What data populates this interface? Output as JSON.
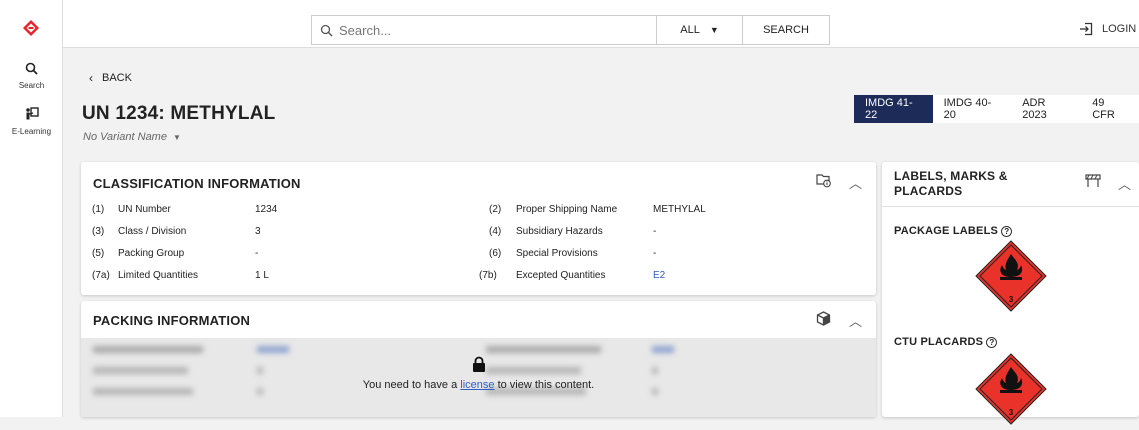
{
  "sidebar": {
    "logo": "logo-icon",
    "items": [
      {
        "label": "Search",
        "icon": "search-icon"
      },
      {
        "label": "E-Learning",
        "icon": "e-learning-icon"
      }
    ]
  },
  "topbar": {
    "search_placeholder": "Search...",
    "scope": "ALL",
    "search_button": "SEARCH",
    "login": "LOGIN"
  },
  "nav": {
    "back": "BACK"
  },
  "page": {
    "title": "UN 1234: METHYLAL",
    "variant": "No Variant Name"
  },
  "versions": [
    {
      "label": "IMDG 41-22",
      "active": true
    },
    {
      "label": "IMDG 40-20",
      "active": false
    },
    {
      "label": "ADR 2023",
      "active": false
    },
    {
      "label": "49 CFR",
      "active": false
    }
  ],
  "classification": {
    "title": "CLASSIFICATION INFORMATION",
    "rows": [
      {
        "num": "(1)",
        "label": "UN Number",
        "value": "1234"
      },
      {
        "num": "(3)",
        "label": "Class / Division",
        "value": "3"
      },
      {
        "num": "(5)",
        "label": "Packing Group",
        "value": "-"
      },
      {
        "num": "(7a)",
        "label": "Limited Quantities",
        "value": "1 L"
      }
    ],
    "rows_right": [
      {
        "num": "(2)",
        "label": "Proper Shipping Name",
        "value": "METHYLAL"
      },
      {
        "num": "(4)",
        "label": "Subsidiary Hazards",
        "value": "-"
      },
      {
        "num": "(6)",
        "label": "Special Provisions",
        "value": "-"
      },
      {
        "num": "(7b)",
        "label": "Excepted Quantities",
        "value": "E2"
      }
    ]
  },
  "packing": {
    "title": "PACKING INFORMATION",
    "locked_prefix": "You need to have a ",
    "locked_link": "license",
    "locked_suffix": " to view this content."
  },
  "labels": {
    "title_line1": "LABELS, MARKS &",
    "title_line2": "PLACARDS",
    "package_labels": "PACKAGE LABELS",
    "ctu_placards": "CTU PLACARDS",
    "label_class": "3"
  },
  "colors": {
    "accent": "#1c2b57",
    "link": "#2f5ec4",
    "hazard_red": "#e8322a"
  }
}
